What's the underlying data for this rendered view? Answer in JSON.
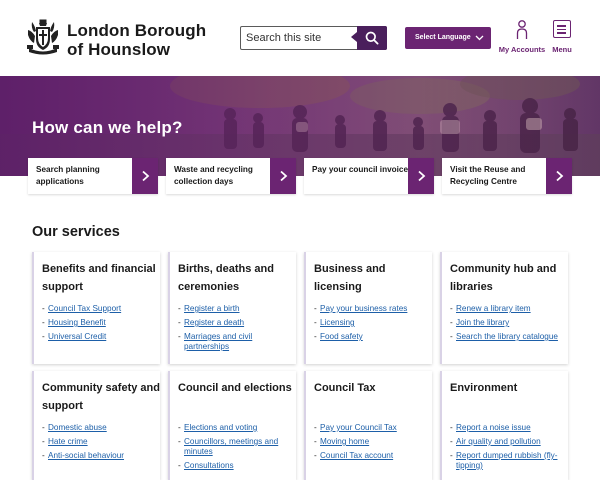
{
  "header": {
    "brand_line1": "London Borough",
    "brand_line2": "of Hounslow",
    "search_placeholder": "Search this site",
    "language_label": "Select Language",
    "accounts_label": "My Accounts",
    "menu_label": "Menu",
    "icons": {
      "logo": "borough-crest-icon",
      "search": "magnifier-icon",
      "language": "chevron-down-icon",
      "accounts": "person-icon",
      "menu": "hamburger-icon"
    }
  },
  "hero": {
    "title": "How can we help?",
    "quick_links": [
      {
        "label": "Search planning applications",
        "icon": "chevron-right-icon"
      },
      {
        "label": "Waste and recycling collection days",
        "icon": "chevron-right-icon"
      },
      {
        "label": "Pay your council invoice",
        "icon": "chevron-right-icon"
      },
      {
        "label": "Visit the Reuse and Recycling Centre",
        "icon": "chevron-right-icon"
      }
    ]
  },
  "services": {
    "title": "Our services",
    "cards": [
      {
        "title": "Benefits and financial support",
        "links": [
          "Council Tax Support",
          "Housing Benefit",
          "Universal Credit"
        ]
      },
      {
        "title": "Births, deaths and ceremonies",
        "links": [
          "Register a birth",
          "Register a death",
          "Marriages and civil partnerships"
        ]
      },
      {
        "title": "Business and licensing",
        "links": [
          "Pay your business rates",
          "Licensing",
          "Food safety"
        ]
      },
      {
        "title": "Community hub and libraries",
        "links": [
          "Renew a library item",
          "Join the library",
          "Search the library catalogue"
        ]
      },
      {
        "title": "Community safety and support",
        "links": [
          "Domestic abuse",
          "Hate crime",
          "Anti-social behaviour"
        ]
      },
      {
        "title": "Council and elections",
        "links": [
          "Elections and voting",
          "Councillors, meetings and minutes",
          "Consultations"
        ]
      },
      {
        "title": "Council Tax",
        "links": [
          "Pay your Council Tax",
          "Moving home",
          "Council Tax account"
        ]
      },
      {
        "title": "Environment",
        "links": [
          "Report a noise issue",
          "Air quality and pollution",
          "Report dumped rubbish (fly-tipping)"
        ]
      }
    ]
  },
  "colors": {
    "brand_purple": "#6b2472",
    "search_button": "#4a1f5c",
    "link_blue": "#1d5fa8",
    "card_border": "#d9d2e6"
  }
}
